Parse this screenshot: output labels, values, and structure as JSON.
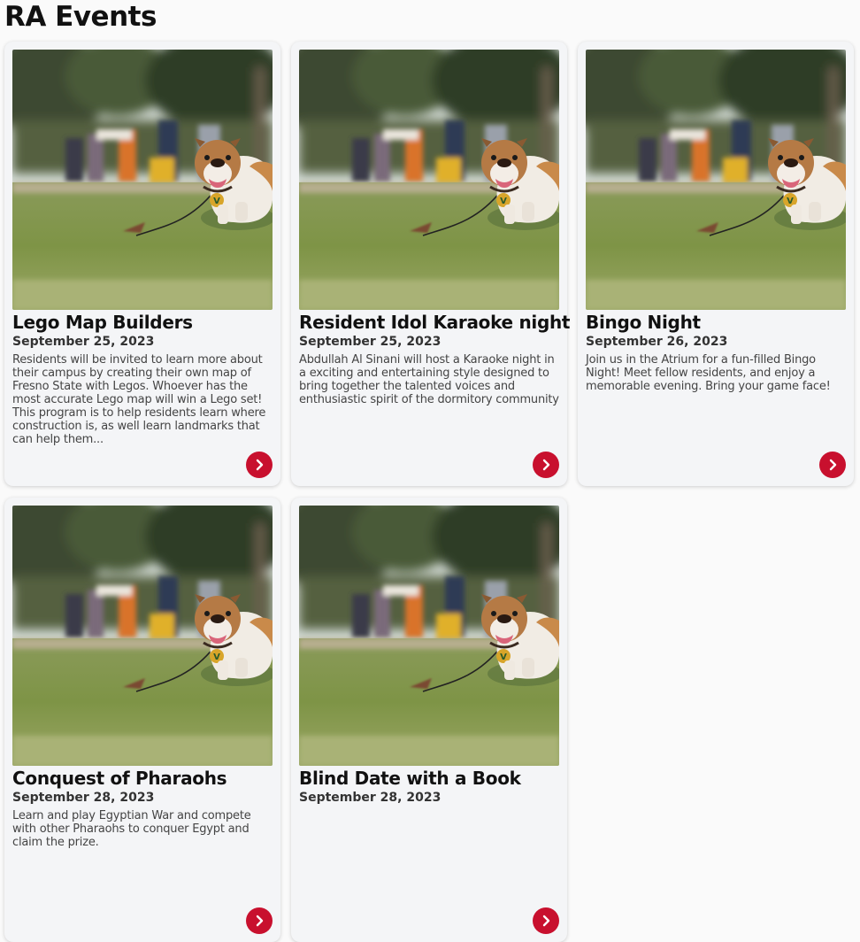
{
  "page": {
    "title": "RA Events"
  },
  "colors": {
    "accent": "#c8102e",
    "card_bg": "#f4f5f7",
    "page_bg": "#fafafa"
  },
  "events": [
    {
      "title": "Lego Map Builders",
      "date": "September 25, 2023",
      "description": "Residents will be invited to learn more about their campus by creating their own map of Fresno State with Legos. Whoever has the most accurate Lego map will win a Lego set! This program is to help residents learn where construction is, as well learn landmarks that can help them...",
      "image_icon": "bulldog-photo",
      "action_icon": "chevron-right-icon"
    },
    {
      "title": "Resident Idol Karaoke night",
      "date": "September 25, 2023",
      "description": "Abdullah Al Sinani will host a Karaoke night in a exciting and entertaining style designed to bring together the talented voices and enthusiastic spirit of the dormitory community",
      "image_icon": "bulldog-photo",
      "action_icon": "chevron-right-icon"
    },
    {
      "title": "Bingo Night",
      "date": "September 26, 2023",
      "description": "Join us in the Atrium for a fun-filled Bingo Night! Meet fellow residents, and enjoy a memorable evening. Bring your game face!",
      "image_icon": "bulldog-photo",
      "action_icon": "chevron-right-icon"
    },
    {
      "title": "Conquest of Pharaohs",
      "date": "September 28, 2023",
      "description": "Learn and play Egyptian War and compete with other Pharaohs to conquer Egypt and claim the prize.",
      "image_icon": "bulldog-photo",
      "action_icon": "chevron-right-icon"
    },
    {
      "title": "Blind Date with a Book",
      "date": "September 28, 2023",
      "description": "",
      "image_icon": "bulldog-photo",
      "action_icon": "chevron-right-icon"
    }
  ]
}
